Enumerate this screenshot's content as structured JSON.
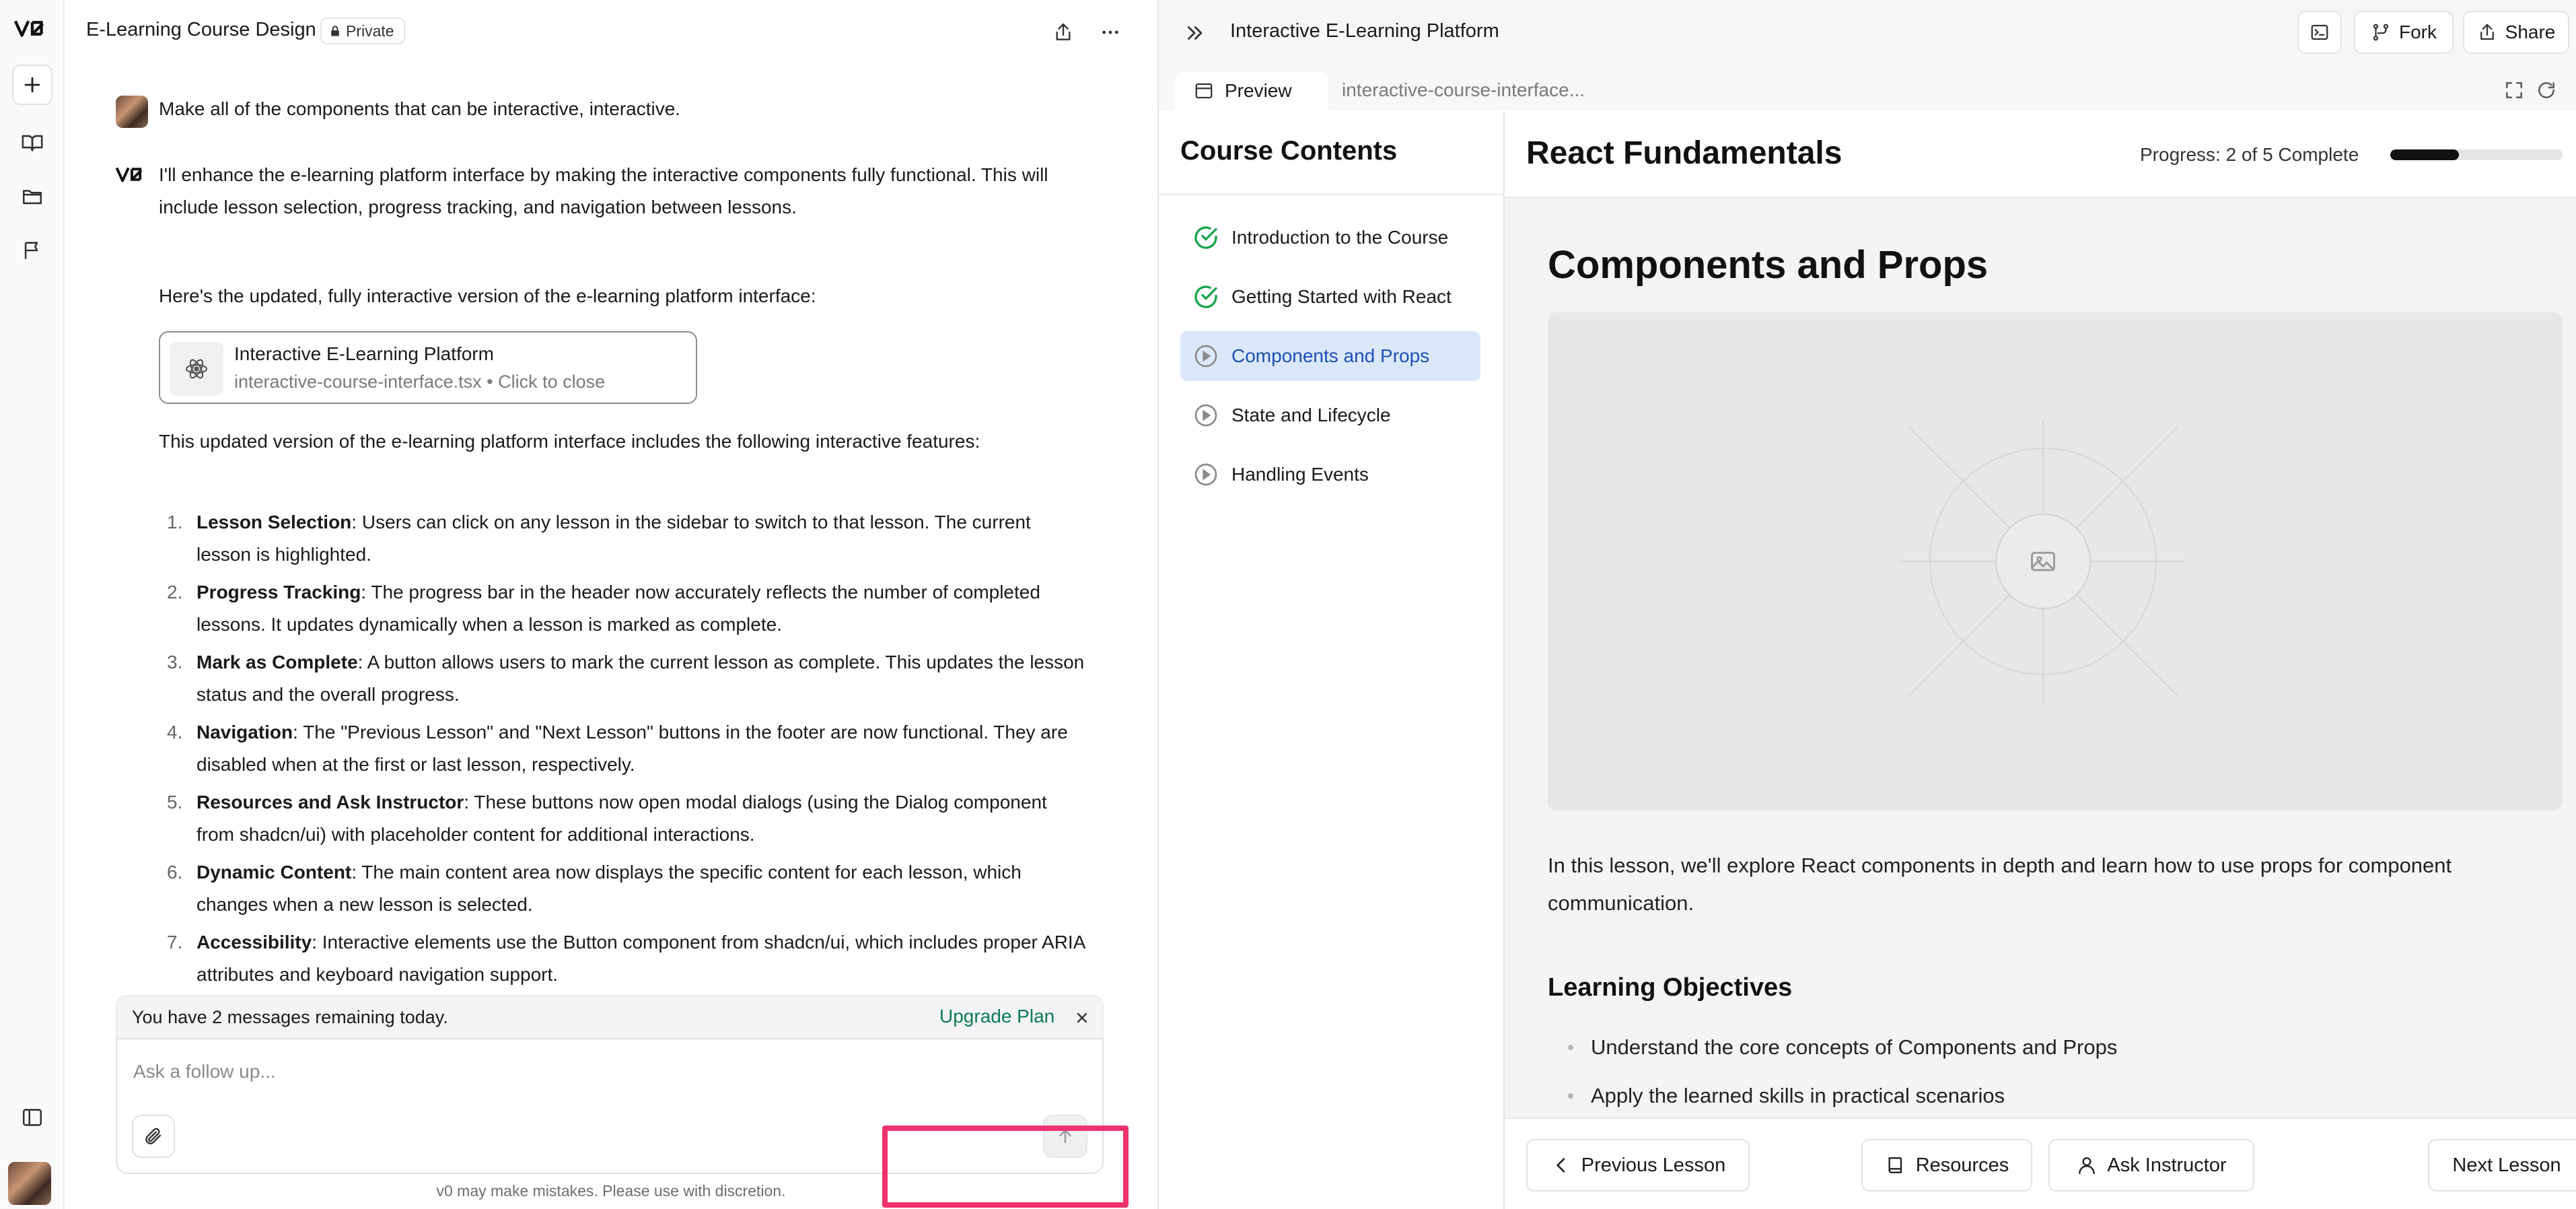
{
  "colors": {
    "accent": "#1d4fb8",
    "active_lesson_bg": "#dbe8fb",
    "complete_green": "#16a34a",
    "upgrade_link": "#0b7a5a",
    "highlight": "#f0326e"
  },
  "icons": {
    "logo": "v0-logo-icon",
    "new": "plus-icon",
    "library": "book-open-icon",
    "projects": "folder-icon",
    "feedback": "flag-icon",
    "sidebar_toggle": "sidebar-icon",
    "lock": "lock-icon",
    "share": "share-icon",
    "more": "more-horizontal-icon",
    "react": "react-atom-icon",
    "attach": "paperclip-icon",
    "send": "arrow-up-icon",
    "close": "close-icon",
    "collapse": "chevrons-right-icon",
    "terminal": "terminal-icon",
    "fork": "git-fork-icon",
    "preview": "browser-window-icon",
    "expand": "expand-icon",
    "refresh": "refresh-icon",
    "complete": "check-circle-icon",
    "incomplete": "play-circle-icon",
    "image_placeholder": "image-icon",
    "prev": "chevron-left-icon",
    "next": "chevron-right-icon",
    "resources": "book-icon",
    "instructor": "user-icon"
  },
  "chat": {
    "title": "E-Learning Course Design",
    "private_label": "Private",
    "user_message": "Make all of the components that can be interactive, interactive.",
    "assistant_intro": "I'll enhance the e-learning platform interface by making the interactive components fully functional. This will include lesson selection, progress tracking, and navigation between lessons.",
    "assistant_lead": "Here's the updated, fully interactive version of the e-learning platform interface:",
    "artifact": {
      "title": "Interactive E-Learning Platform",
      "subtitle": "interactive-course-interface.tsx • Click to close"
    },
    "features_intro": "This updated version of the e-learning platform interface includes the following interactive features:",
    "features": [
      {
        "num": "1.",
        "title": "Lesson Selection",
        "text": ": Users can click on any lesson in the sidebar to switch to that lesson. The current lesson is highlighted."
      },
      {
        "num": "2.",
        "title": "Progress Tracking",
        "text": ": The progress bar in the header now accurately reflects the number of completed lessons. It updates dynamically when a lesson is marked as complete."
      },
      {
        "num": "3.",
        "title": "Mark as Complete",
        "text": ": A button allows users to mark the current lesson as complete. This updates the lesson status and the overall progress."
      },
      {
        "num": "4.",
        "title": "Navigation",
        "text": ": The \"Previous Lesson\" and \"Next Lesson\" buttons in the footer are now functional. They are disabled when at the first or last lesson, respectively."
      },
      {
        "num": "5.",
        "title": "Resources and Ask Instructor",
        "text": ": These buttons now open modal dialogs (using the Dialog component from shadcn/ui) with placeholder content for additional interactions."
      },
      {
        "num": "6.",
        "title": "Dynamic Content",
        "text": ": The main content area now displays the specific content for each lesson, which changes when a new lesson is selected."
      },
      {
        "num": "7.",
        "title": "Accessibility",
        "text": ": Interactive elements use the Button component from shadcn/ui, which includes proper ARIA attributes and keyboard navigation support."
      }
    ],
    "limit_text": "You have 2 messages remaining today.",
    "upgrade_label": "Upgrade Plan",
    "input_placeholder": "Ask a follow up...",
    "input_value": "",
    "disclaimer": "v0 may make mistakes. Please use with discretion."
  },
  "preview": {
    "title": "Interactive E-Learning Platform",
    "fork_label": "Fork",
    "share_label": "Share",
    "tab_preview": "Preview",
    "tab_file": "interactive-course-interface..."
  },
  "course": {
    "sidebar_title": "Course Contents",
    "lessons": [
      {
        "title": "Introduction to the Course",
        "status": "complete",
        "active": false
      },
      {
        "title": "Getting Started with React",
        "status": "complete",
        "active": false
      },
      {
        "title": "Components and Props",
        "status": "incomplete",
        "active": true
      },
      {
        "title": "State and Lifecycle",
        "status": "incomplete",
        "active": false
      },
      {
        "title": "Handling Events",
        "status": "incomplete",
        "active": false
      }
    ],
    "title": "React Fundamentals",
    "progress_label": "Progress: 2 of 5 Complete",
    "progress_completed": 2,
    "progress_total": 5,
    "lesson_heading": "Components and Props",
    "lesson_intro": "In this lesson, we'll explore React components in depth and learn how to use props for component communication.",
    "objectives_title": "Learning Objectives",
    "objectives": [
      "Understand the core concepts of Components and Props",
      "Apply the learned skills in practical scenarios"
    ],
    "prev_label": "Previous Lesson",
    "resources_label": "Resources",
    "ask_label": "Ask Instructor",
    "next_label": "Next Lesson"
  }
}
